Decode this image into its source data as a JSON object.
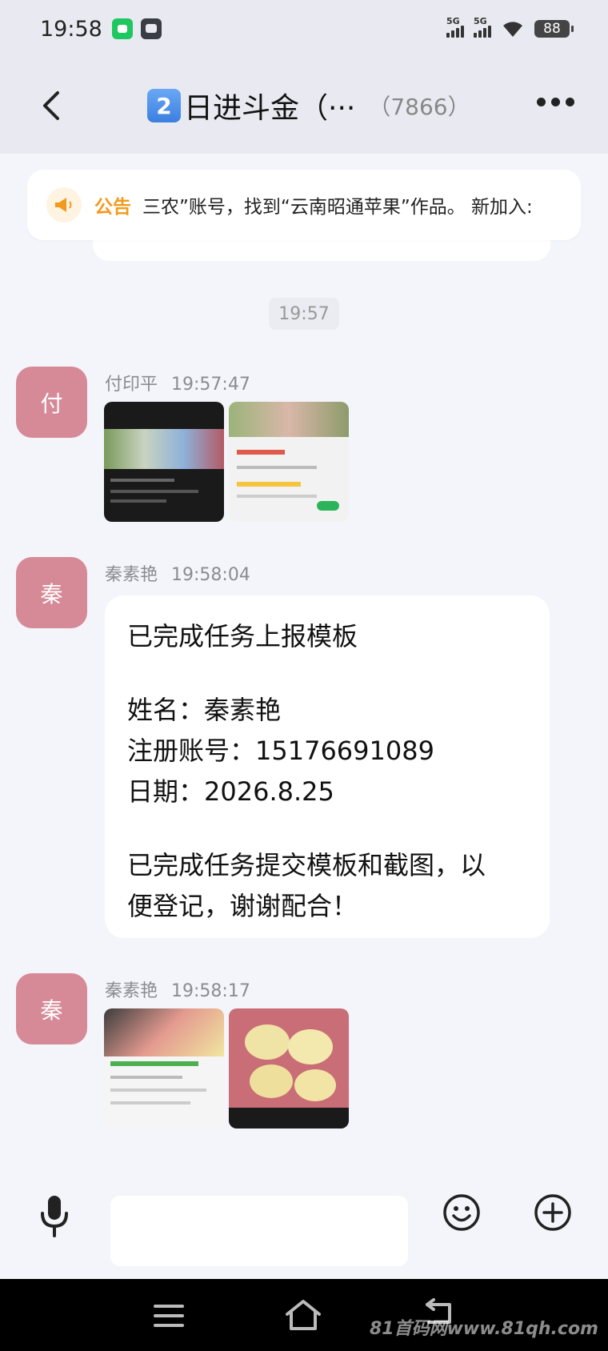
{
  "status_bar": {
    "time": "19:58",
    "signal1": "5G",
    "signal2": "5G",
    "battery": "88"
  },
  "header": {
    "emoji_badge": "2",
    "title": "日进斗金（···",
    "member_count": "（7866）"
  },
  "notice": {
    "label": "公告",
    "text": "三农”账号，找到“云南昭通苹果”作品。  新加入:"
  },
  "time_divider": "19:57",
  "messages": [
    {
      "avatar": "付",
      "sender": "付印平",
      "time": "19:57:47",
      "type": "images"
    },
    {
      "avatar": "秦",
      "sender": "秦素艳",
      "time": "19:58:04",
      "type": "text",
      "lines": [
        "已完成任务上报模板",
        "",
        "姓名：秦素艳",
        "注册账号：15176691089",
        "日期：2026.8.25",
        "",
        "已完成任务提交模板和截图，以",
        "便登记，谢谢配合！"
      ]
    },
    {
      "avatar": "秦",
      "sender": "秦素艳",
      "time": "19:58:17",
      "type": "images"
    }
  ],
  "input": {
    "placeholder": "",
    "value": ""
  },
  "watermark": "81首码网www.81qh.com",
  "colors": {
    "avatar": "#d68a97",
    "notice_label": "#f39a1e",
    "background": "#f4f5fa"
  }
}
